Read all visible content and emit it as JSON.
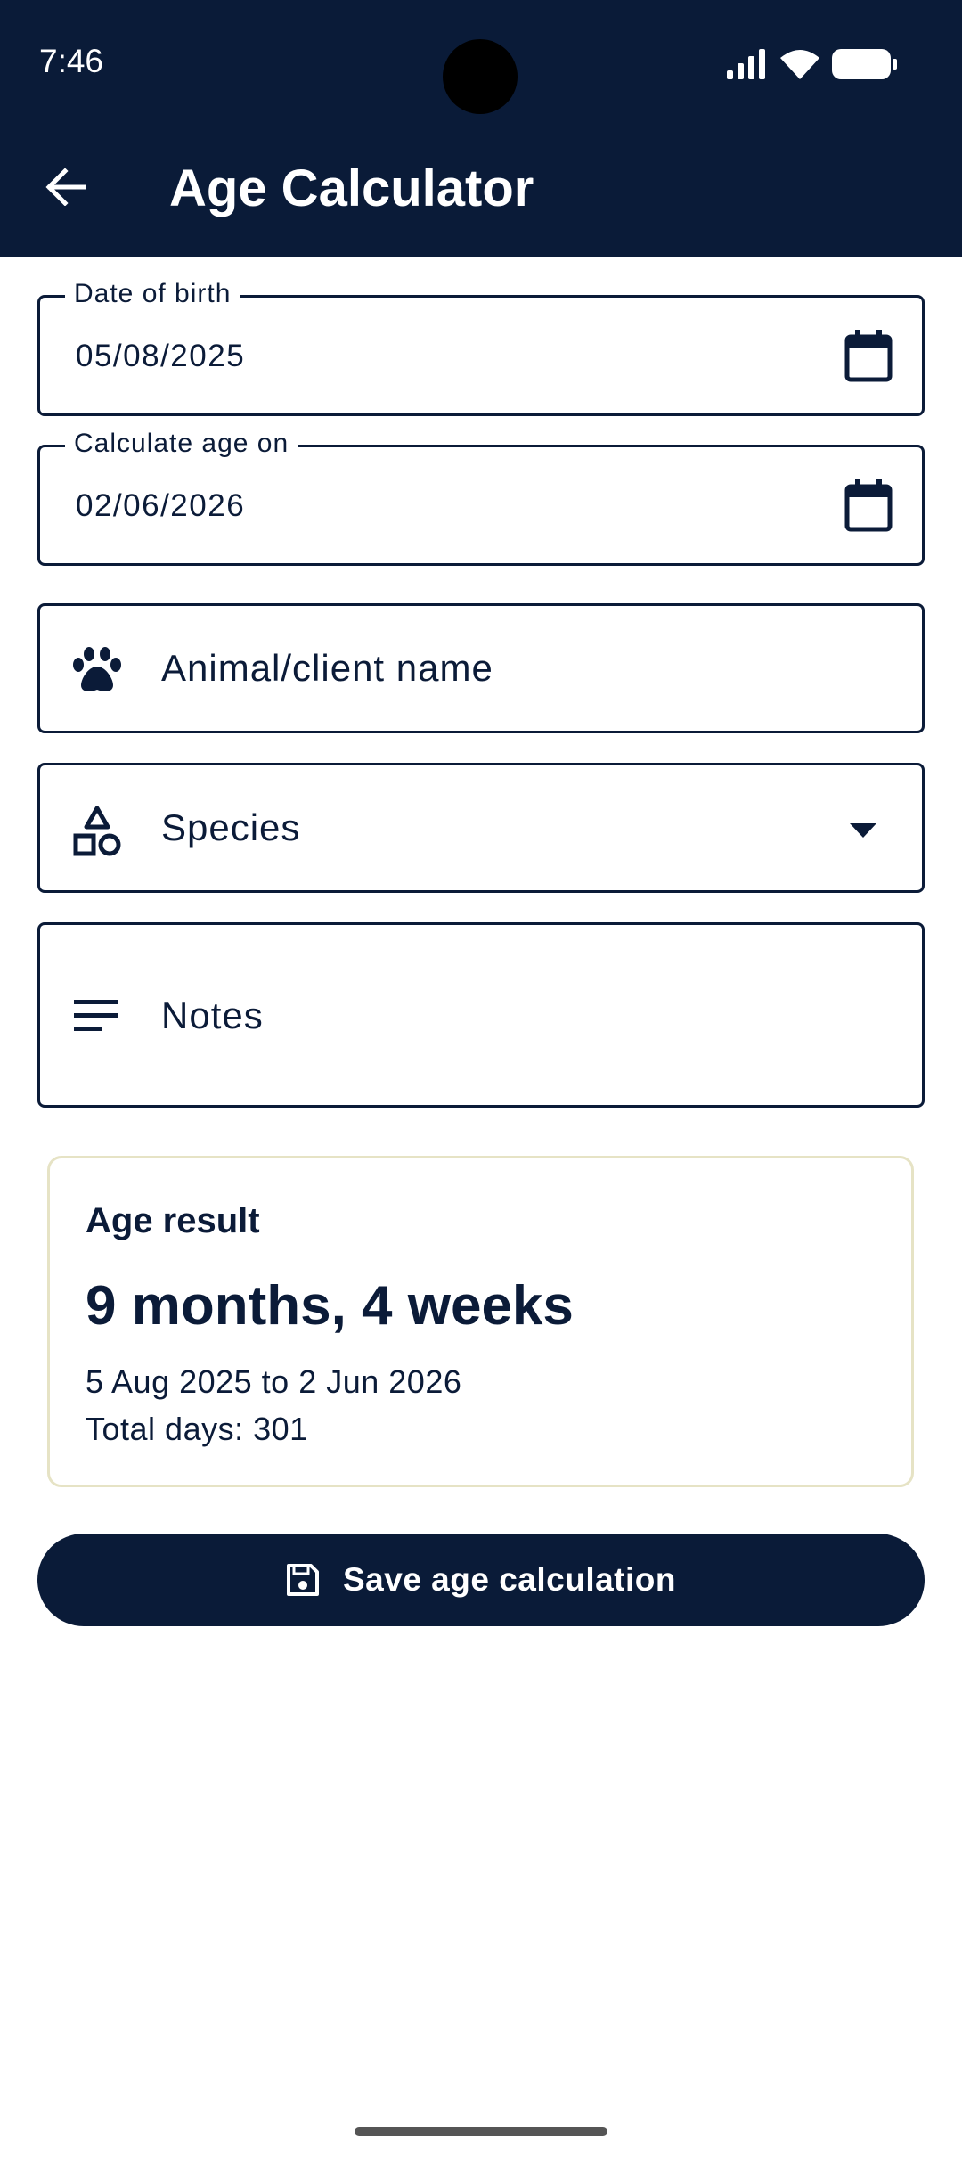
{
  "status_bar": {
    "time": "7:46",
    "icons": [
      "signal-icon",
      "wifi-icon",
      "battery-icon"
    ]
  },
  "app_bar": {
    "title": "Age Calculator",
    "back_icon": "arrow-back-icon"
  },
  "form": {
    "date_of_birth": {
      "label": "Date of birth",
      "value": "05/08/2025",
      "icon": "calendar-icon"
    },
    "calculate_on": {
      "label": "Calculate age on",
      "value": "02/06/2026",
      "icon": "calendar-icon"
    },
    "animal_name": {
      "placeholder": "Animal/client name",
      "icon": "paw-icon"
    },
    "species": {
      "placeholder": "Species",
      "icon": "shapes-icon",
      "dropdown_icon": "dropdown-arrow-icon"
    },
    "notes": {
      "placeholder": "Notes",
      "icon": "notes-icon"
    }
  },
  "result": {
    "label": "Age result",
    "value": "9 months, 4 weeks",
    "range": "5 Aug 2025 to 2 Jun 2026",
    "total_days": "Total days: 301"
  },
  "actions": {
    "save_label": "Save age calculation",
    "save_icon": "save-icon"
  },
  "colors": {
    "primary": "#0a1b38",
    "card_border": "#e6e3c5",
    "background": "#ffffff"
  }
}
